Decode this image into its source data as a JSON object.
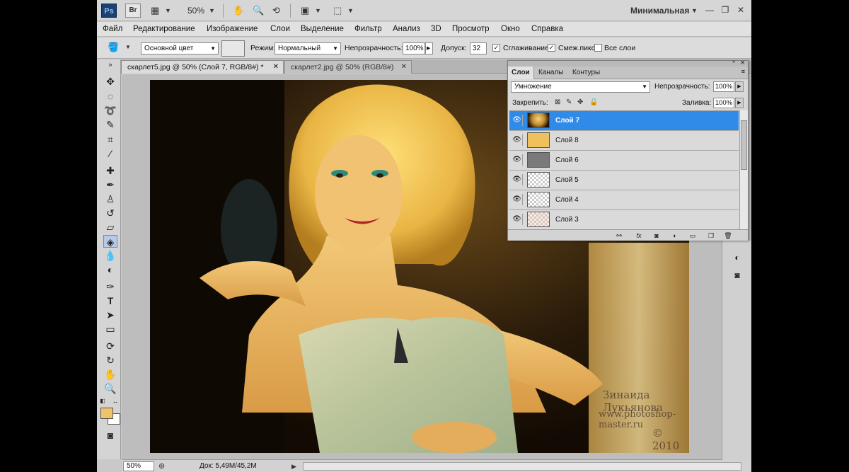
{
  "appbar": {
    "ps_logo": "Ps",
    "br_logo": "Br",
    "zoom_label": "50%",
    "workspace": "Минимальная"
  },
  "menu": [
    "Файл",
    "Редактирование",
    "Изображение",
    "Слои",
    "Выделение",
    "Фильтр",
    "Анализ",
    "3D",
    "Просмотр",
    "Окно",
    "Справка"
  ],
  "options": {
    "fill_source": "Основной цвет",
    "mode_label": "Режим:",
    "mode_value": "Нормальный",
    "opacity_label": "Непрозрачность:",
    "opacity_value": "100%",
    "tolerance_label": "Допуск:",
    "tolerance_value": "32",
    "antialias_label": "Сглаживание",
    "contiguous_label": "Смеж.пикс",
    "all_layers_label": "Все слои"
  },
  "tabs": [
    {
      "label": "скарлет5.jpg @ 50% (Слой 7, RGB/8#) *"
    },
    {
      "label": "скарлет2.jpg @ 50% (RGB/8#)"
    }
  ],
  "layers_panel": {
    "tabs": [
      "Слои",
      "Каналы",
      "Контуры"
    ],
    "blend_mode": "Умножение",
    "opacity_label": "Непрозрачность:",
    "opacity_value": "100%",
    "lock_label": "Закрепить:",
    "fill_label": "Заливка:",
    "fill_value": "100%",
    "layers": [
      {
        "name": "Слой 7",
        "thumb": "photo",
        "selected": true
      },
      {
        "name": "Слой 8",
        "thumb": "#f0c05c",
        "selected": false
      },
      {
        "name": "Слой 6",
        "thumb": "#7a7a7a",
        "selected": false
      },
      {
        "name": "Слой 5",
        "thumb": "transparent",
        "selected": false
      },
      {
        "name": "Слой 4",
        "thumb": "transparent",
        "selected": false
      },
      {
        "name": "Слой 3",
        "thumb": "transparent-dots",
        "selected": false
      }
    ]
  },
  "watermark": {
    "author": "Зинаида Лукьянова",
    "site": "www.photoshop-master.ru",
    "year": "© 2010"
  },
  "status": {
    "zoom": "50%",
    "doc": "Док: 5,49M/45,2M"
  },
  "colors": {
    "foreground": "#f0c26a",
    "background": "#ffffff",
    "selection": "#2f8be7"
  }
}
